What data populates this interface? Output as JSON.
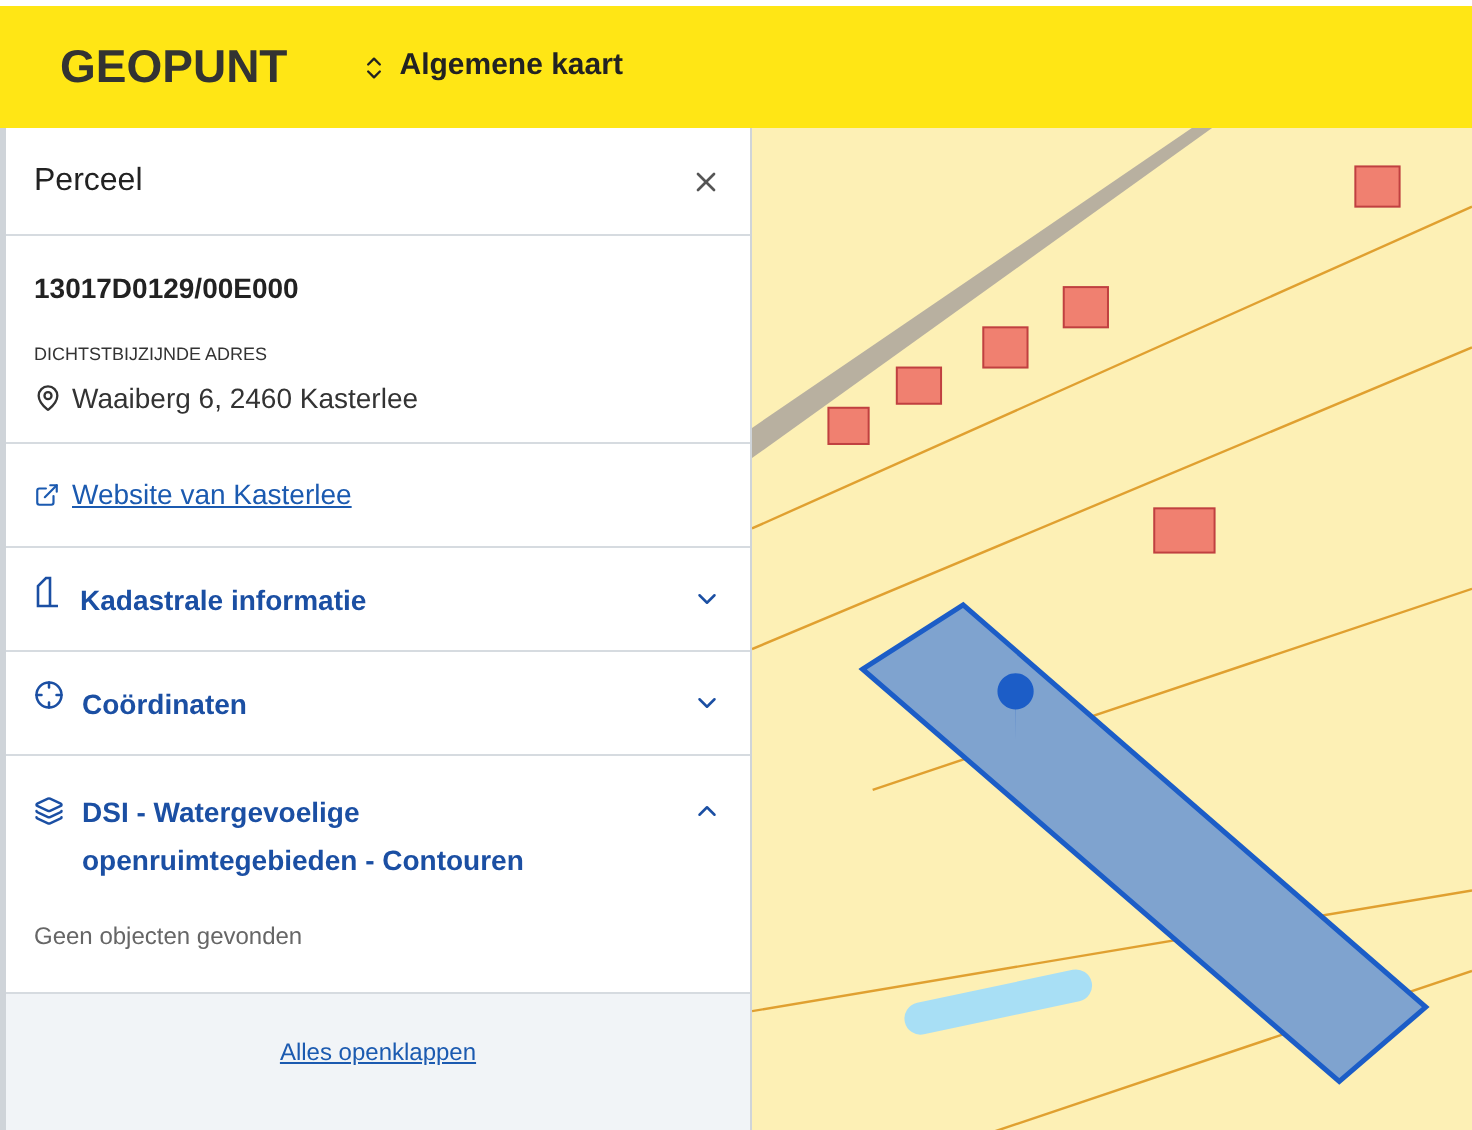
{
  "header": {
    "logo": "GEOPUNT",
    "map_selector": "Algemene kaart"
  },
  "panel": {
    "title": "Perceel",
    "parcel_id": "13017D0129/00E000",
    "address_label": "DICHTSTBIJZIJNDE ADRES",
    "address": "Waaiberg 6, 2460 Kasterlee",
    "link": "Website van Kasterlee",
    "sections": [
      {
        "kind": "building",
        "title": "Kadastrale informatie",
        "expanded": false
      },
      {
        "kind": "crosshair",
        "title": "Coördinaten",
        "expanded": false
      },
      {
        "kind": "layers",
        "title": "DSI - Watergevoelige openruimtegebieden - Contouren",
        "expanded": true,
        "message": "Geen objecten gevonden"
      }
    ],
    "expand_all": "Alles openklappen"
  }
}
